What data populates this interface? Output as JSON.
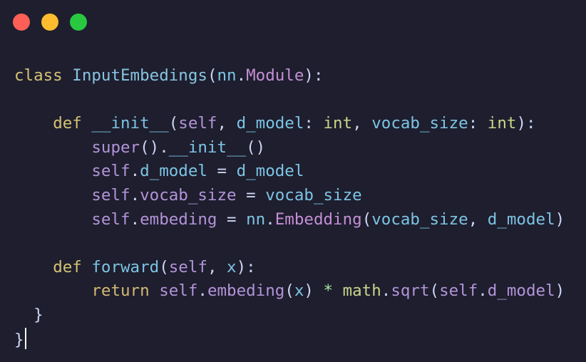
{
  "window": {
    "controls": [
      {
        "name": "close-button",
        "color": "#ff5f57"
      },
      {
        "name": "minimize-button",
        "color": "#febc2e"
      },
      {
        "name": "zoom-button",
        "color": "#28c840"
      }
    ]
  },
  "palette": {
    "keyword": "#d4c275",
    "classname": "#89c4e1",
    "punct": "#cdd6f4",
    "module": "#c48fd4",
    "self": "#b394d8",
    "param": "#7dc4e4",
    "type": "#c9d48a",
    "builtin": "#d4b972",
    "attr": "#b394d8",
    "operator": "#a6e3a1"
  },
  "code": {
    "lines": [
      [
        {
          "t": "class",
          "c": "keyword"
        },
        {
          "t": " ",
          "c": "punct"
        },
        {
          "t": "InputEmbedings",
          "c": "classname"
        },
        {
          "t": "(",
          "c": "punct"
        },
        {
          "t": "nn",
          "c": "param"
        },
        {
          "t": ".",
          "c": "punct"
        },
        {
          "t": "Module",
          "c": "module"
        },
        {
          "t": "):",
          "c": "punct"
        }
      ],
      [],
      [
        {
          "t": "    ",
          "c": "punct"
        },
        {
          "t": "def",
          "c": "keyword"
        },
        {
          "t": " ",
          "c": "punct"
        },
        {
          "t": "__init__",
          "c": "param"
        },
        {
          "t": "(",
          "c": "punct"
        },
        {
          "t": "self",
          "c": "self"
        },
        {
          "t": ", ",
          "c": "punct"
        },
        {
          "t": "d_model",
          "c": "param"
        },
        {
          "t": ": ",
          "c": "punct"
        },
        {
          "t": "int",
          "c": "type"
        },
        {
          "t": ", ",
          "c": "punct"
        },
        {
          "t": "vocab_size",
          "c": "param"
        },
        {
          "t": ": ",
          "c": "punct"
        },
        {
          "t": "int",
          "c": "type"
        },
        {
          "t": "):",
          "c": "punct"
        }
      ],
      [
        {
          "t": "        ",
          "c": "punct"
        },
        {
          "t": "super",
          "c": "self"
        },
        {
          "t": "().",
          "c": "punct"
        },
        {
          "t": "__init__",
          "c": "param"
        },
        {
          "t": "()",
          "c": "punct"
        }
      ],
      [
        {
          "t": "        ",
          "c": "punct"
        },
        {
          "t": "self",
          "c": "self"
        },
        {
          "t": ".",
          "c": "punct"
        },
        {
          "t": "d_model",
          "c": "param"
        },
        {
          "t": " = ",
          "c": "punct"
        },
        {
          "t": "d_model",
          "c": "param"
        }
      ],
      [
        {
          "t": "        ",
          "c": "punct"
        },
        {
          "t": "self",
          "c": "self"
        },
        {
          "t": ".",
          "c": "punct"
        },
        {
          "t": "vocab_size",
          "c": "attr"
        },
        {
          "t": " = ",
          "c": "punct"
        },
        {
          "t": "vocab_size",
          "c": "param"
        }
      ],
      [
        {
          "t": "        ",
          "c": "punct"
        },
        {
          "t": "self",
          "c": "self"
        },
        {
          "t": ".",
          "c": "punct"
        },
        {
          "t": "embeding",
          "c": "attr"
        },
        {
          "t": " = ",
          "c": "punct"
        },
        {
          "t": "nn",
          "c": "param"
        },
        {
          "t": ".",
          "c": "punct"
        },
        {
          "t": "Embedding",
          "c": "module"
        },
        {
          "t": "(",
          "c": "punct"
        },
        {
          "t": "vocab_size",
          "c": "param"
        },
        {
          "t": ", ",
          "c": "punct"
        },
        {
          "t": "d_model",
          "c": "param"
        },
        {
          "t": ")",
          "c": "punct"
        }
      ],
      [],
      [
        {
          "t": "    ",
          "c": "punct"
        },
        {
          "t": "def",
          "c": "keyword"
        },
        {
          "t": " ",
          "c": "punct"
        },
        {
          "t": "forward",
          "c": "param"
        },
        {
          "t": "(",
          "c": "punct"
        },
        {
          "t": "self",
          "c": "self"
        },
        {
          "t": ", ",
          "c": "punct"
        },
        {
          "t": "x",
          "c": "param"
        },
        {
          "t": "):",
          "c": "punct"
        }
      ],
      [
        {
          "t": "        ",
          "c": "punct"
        },
        {
          "t": "return",
          "c": "builtin"
        },
        {
          "t": " ",
          "c": "punct"
        },
        {
          "t": "self",
          "c": "self"
        },
        {
          "t": ".",
          "c": "punct"
        },
        {
          "t": "embeding",
          "c": "attr"
        },
        {
          "t": "(",
          "c": "punct"
        },
        {
          "t": "x",
          "c": "param"
        },
        {
          "t": ") ",
          "c": "punct"
        },
        {
          "t": "*",
          "c": "operator"
        },
        {
          "t": " ",
          "c": "punct"
        },
        {
          "t": "math",
          "c": "type"
        },
        {
          "t": ".",
          "c": "punct"
        },
        {
          "t": "sqrt",
          "c": "self"
        },
        {
          "t": "(",
          "c": "punct"
        },
        {
          "t": "self",
          "c": "self"
        },
        {
          "t": ".",
          "c": "punct"
        },
        {
          "t": "d_model",
          "c": "attr"
        },
        {
          "t": ")",
          "c": "punct"
        }
      ],
      [
        {
          "t": "  }",
          "c": "punct"
        }
      ],
      [
        {
          "t": "}",
          "c": "punct"
        }
      ]
    ]
  }
}
